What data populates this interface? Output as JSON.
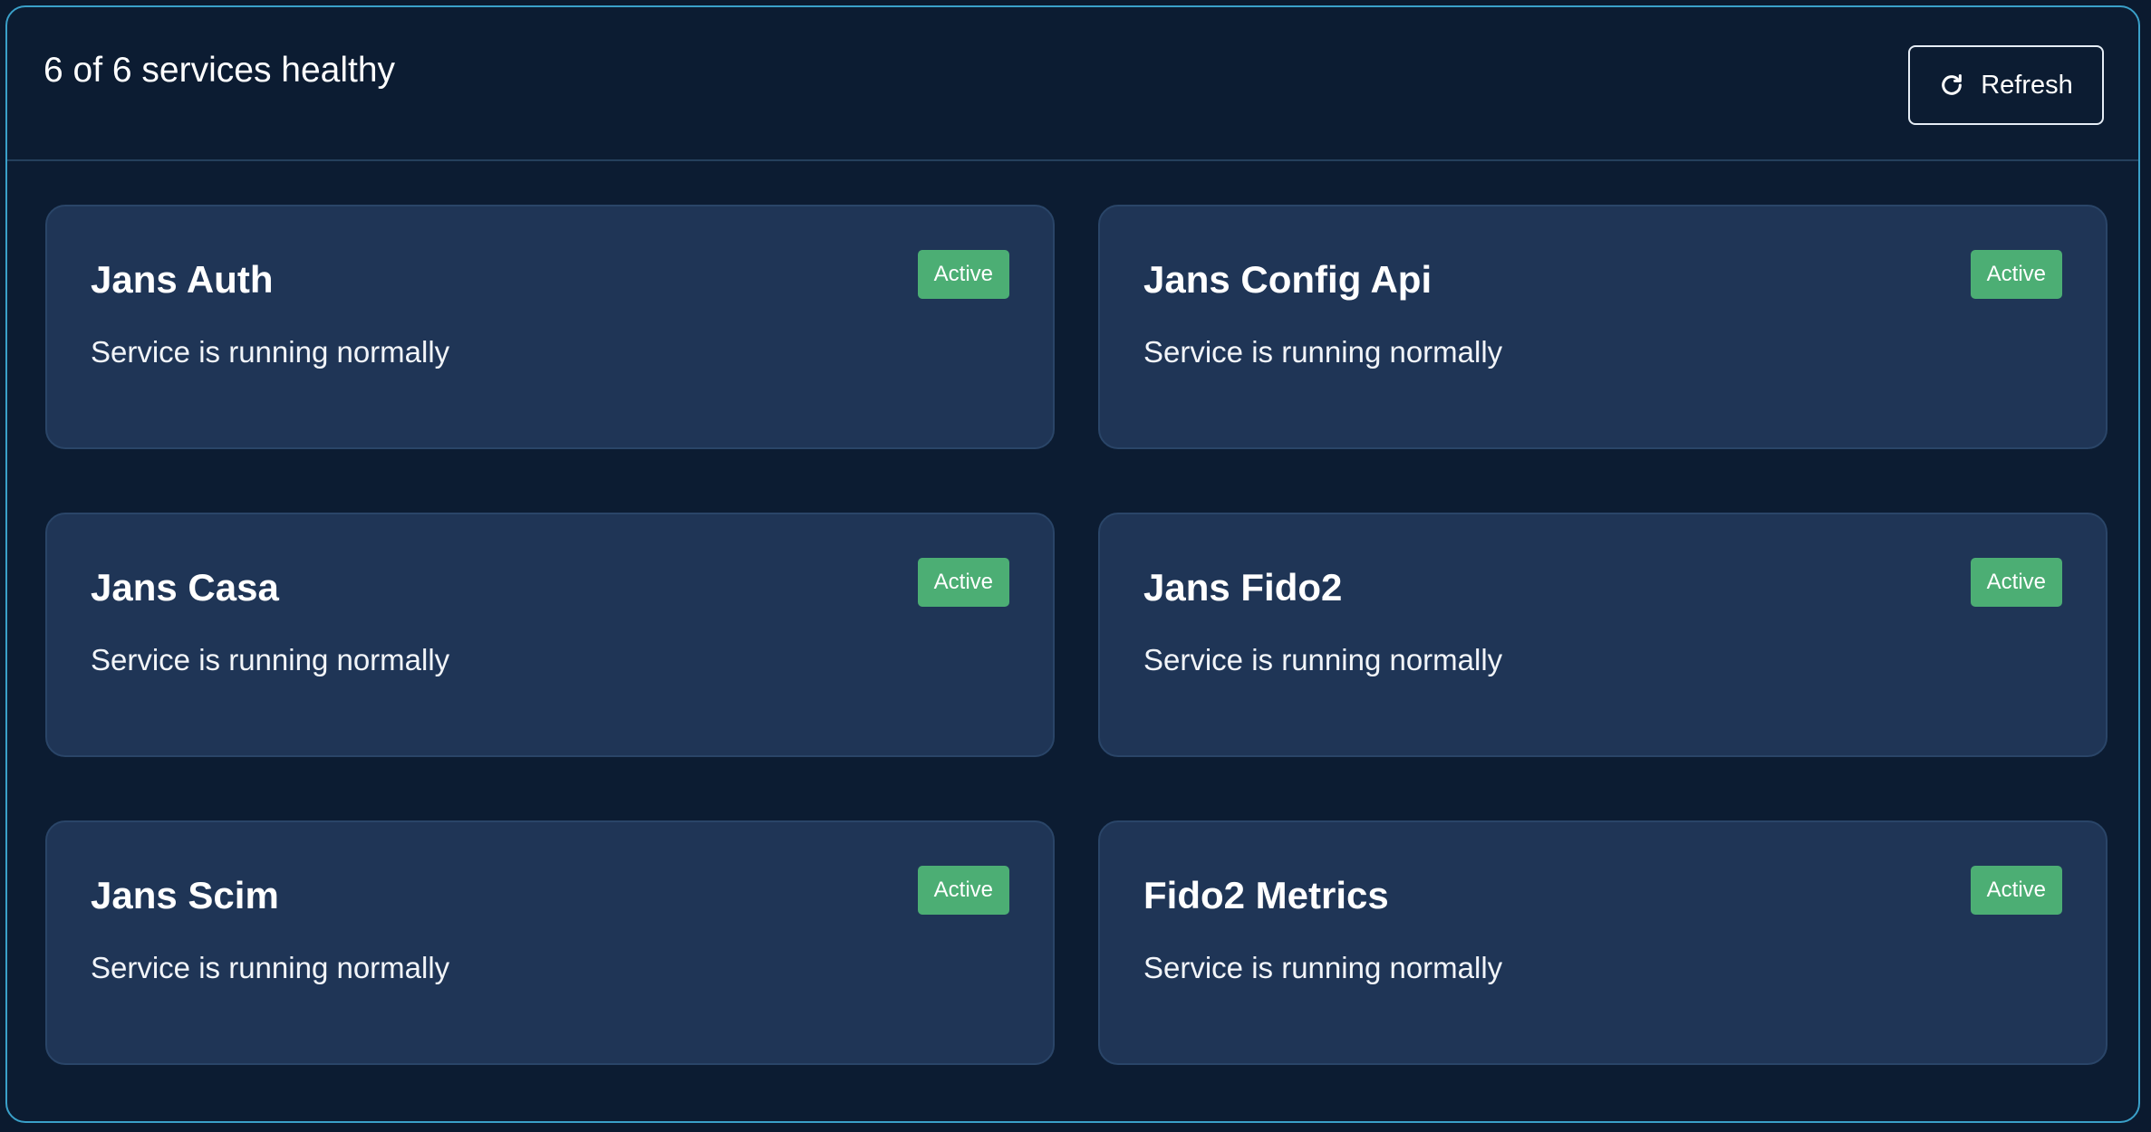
{
  "header": {
    "summary": "6 of 6 services healthy",
    "refresh_label": "Refresh",
    "refresh_icon": "refresh-icon"
  },
  "colors": {
    "background": "#0c1c32",
    "border_accent": "#3aa0c9",
    "card_background": "#1f3556",
    "status_active": "#4cae74"
  },
  "services": [
    {
      "name": "Jans Auth",
      "status": "Active",
      "description": "Service is running normally"
    },
    {
      "name": "Jans Config Api",
      "status": "Active",
      "description": "Service is running normally"
    },
    {
      "name": "Jans Casa",
      "status": "Active",
      "description": "Service is running normally"
    },
    {
      "name": "Jans Fido2",
      "status": "Active",
      "description": "Service is running normally"
    },
    {
      "name": "Jans Scim",
      "status": "Active",
      "description": "Service is running normally"
    },
    {
      "name": "Fido2 Metrics",
      "status": "Active",
      "description": "Service is running normally"
    }
  ]
}
